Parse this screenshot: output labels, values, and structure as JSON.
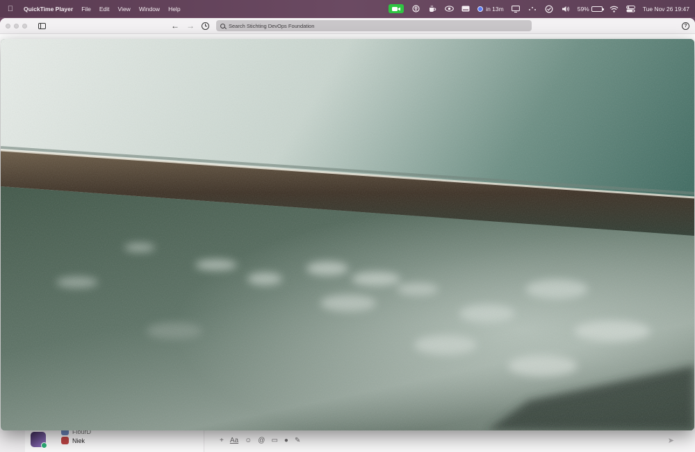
{
  "menubar": {
    "app_name": "QuickTime Player",
    "menus": [
      "File",
      "Edit",
      "View",
      "Window",
      "Help"
    ],
    "meeting_text": "in 13m",
    "battery_text": "59%",
    "battery_level": 0.59,
    "datetime": "Tue Nov 26  19:47",
    "status_icons": [
      "facetime-video-icon",
      "accessibility-icon",
      "coffee-icon",
      "eye-icon",
      "keyboard-icon",
      "calendar-icon",
      "display-icon",
      "dots-icon",
      "sync-icon",
      "volume-icon",
      "wifi-icon",
      "control-center-icon"
    ]
  },
  "background_window": {
    "search_placeholder": "Search Stichting DevOps Foundation",
    "dm_items": [
      {
        "label": "FlourD"
      },
      {
        "label": "Niek"
      }
    ],
    "composer_icons": [
      "plus-icon",
      "format-icon",
      "emoji-icon",
      "mention-icon",
      "video-icon",
      "mic-icon",
      "shortcut-icon",
      "send-icon"
    ]
  },
  "colors": {
    "menubar": "#6b4a62",
    "facetime": "#2fc542",
    "presence": "#2bac76"
  }
}
